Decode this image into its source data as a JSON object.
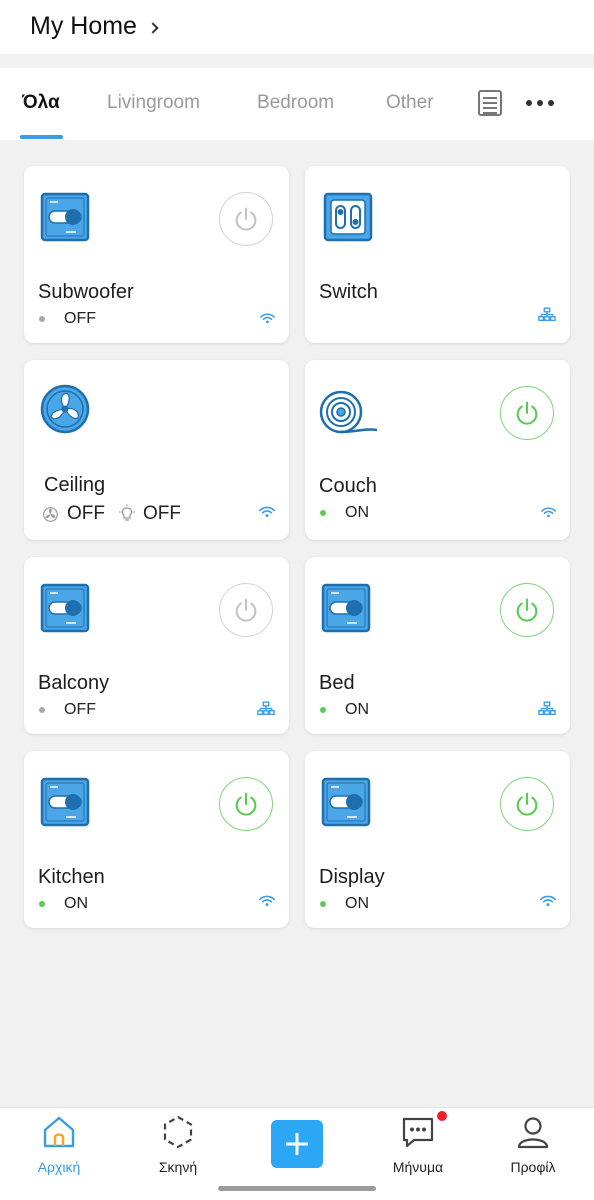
{
  "header": {
    "title": "My Home"
  },
  "tabs": [
    {
      "label": "Όλα",
      "active": true
    },
    {
      "label": "Livingroom",
      "active": false
    },
    {
      "label": "Bedroom",
      "active": false
    },
    {
      "label": "Other",
      "active": false
    }
  ],
  "devices": [
    {
      "name": "Subwoofer",
      "status": "OFF",
      "on": false,
      "icon": "wall-switch-icon",
      "connection": "wifi"
    },
    {
      "name": "Switch",
      "status": "",
      "on": false,
      "icon": "double-switch-icon",
      "connection": "hub"
    },
    {
      "name": "Ceiling",
      "fan_status": "OFF",
      "light_status": "OFF",
      "icon": "fan-icon",
      "connection": "wifi"
    },
    {
      "name": "Couch",
      "status": "ON",
      "on": true,
      "icon": "led-strip-icon",
      "connection": "wifi"
    },
    {
      "name": "Balcony",
      "status": "OFF",
      "on": false,
      "icon": "wall-switch-icon",
      "connection": "hub"
    },
    {
      "name": "Bed",
      "status": "ON",
      "on": true,
      "icon": "wall-switch-icon",
      "connection": "hub"
    },
    {
      "name": "Kitchen",
      "status": "ON",
      "on": true,
      "icon": "wall-switch-icon",
      "connection": "wifi"
    },
    {
      "name": "Display",
      "status": "ON",
      "on": true,
      "icon": "wall-switch-icon",
      "connection": "wifi"
    }
  ],
  "nav": {
    "home": "Αρχική",
    "scene": "Σκηνή",
    "messages": "Μήνυμα",
    "profile": "Προφίλ"
  },
  "colors": {
    "accent": "#3a9be6",
    "add_button": "#2ba7f5",
    "on_green": "#5ccb55",
    "off_gray": "#bdbdbd",
    "badge": "#f0202a"
  }
}
